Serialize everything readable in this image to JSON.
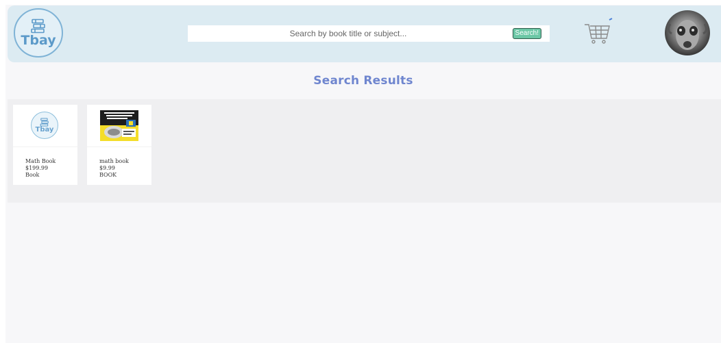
{
  "header": {
    "logo_text": "Tbay",
    "search": {
      "placeholder": "Search by book title or subject...",
      "value": "",
      "button_label": "Search!"
    }
  },
  "page_title": "Search Results",
  "results": [
    {
      "name": "Math Book",
      "price": "$199.99",
      "type": "Book",
      "thumb": "tbay-logo"
    },
    {
      "name": "math book",
      "price": "$9.99",
      "type": "BOOK",
      "thumb": "book-cover"
    }
  ],
  "colors": {
    "header_bg": "#dcebf2",
    "title": "#6f86cf",
    "search_button": "#6cc7a6",
    "logo": "#5c9ac9"
  },
  "icons": [
    "books-icon",
    "cart-icon",
    "avatar"
  ]
}
